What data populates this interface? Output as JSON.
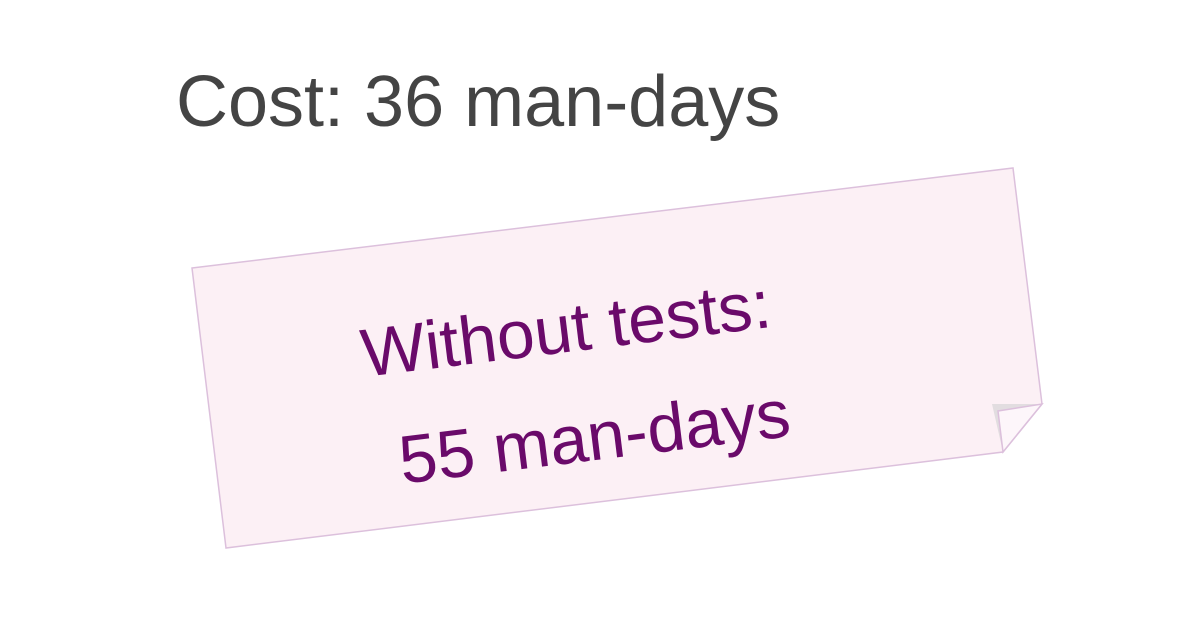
{
  "title": "Cost: 36 man-days",
  "note": {
    "line1": "Without tests:",
    "line2": "55 man-days",
    "fill_color": "#fcf0f5",
    "border_color": "#d8b8d8",
    "text_color": "#6a0a6a"
  }
}
